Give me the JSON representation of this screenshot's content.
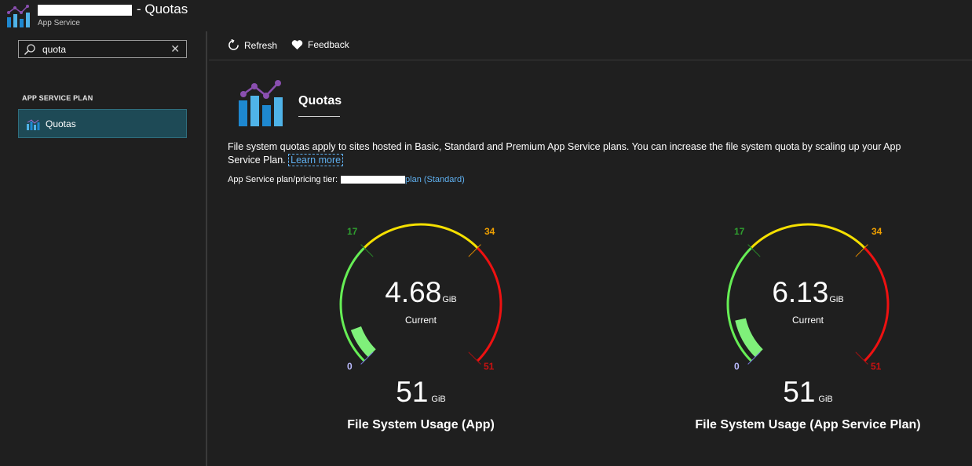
{
  "header": {
    "title_suffix": "- Quotas",
    "subtitle": "App Service"
  },
  "search": {
    "value": "quota",
    "clear_glyph": "✕"
  },
  "sidebar": {
    "section_label": "APP SERVICE PLAN",
    "items": [
      {
        "label": "Quotas",
        "icon": "bar-chart-icon",
        "selected": true
      }
    ]
  },
  "toolbar": {
    "refresh_label": "Refresh",
    "feedback_label": "Feedback"
  },
  "page": {
    "title": "Quotas",
    "description_line1": "File system quotas apply to sites hosted in Basic, Standard and Premium App Service plans. You can increase the file system quota by scaling up your App",
    "description_line2": "Service Plan.",
    "learn_more": "Learn more",
    "tier_label": "App Service plan/pricing tier:",
    "tier_value": "plan (Standard)"
  },
  "gauges": [
    {
      "name": "File System Usage (App)",
      "current_value": "4.68",
      "current_unit": "GiB",
      "current_label": "Current",
      "total_value": "51",
      "total_unit": "GiB",
      "tick_min": "0",
      "tick_green": "17",
      "tick_yellow": "34",
      "tick_max": "51",
      "fill_fraction": 0.0918
    },
    {
      "name": "File System Usage (App Service Plan)",
      "current_value": "6.13",
      "current_unit": "GiB",
      "current_label": "Current",
      "total_value": "51",
      "total_unit": "GiB",
      "tick_min": "0",
      "tick_green": "17",
      "tick_yellow": "34",
      "tick_max": "51",
      "fill_fraction": 0.1202
    }
  ],
  "colors": {
    "accent": "#5fb0f0",
    "green": "#66ee55",
    "yellow": "#f5e000",
    "red": "#ee1111",
    "fill": "#7ff07a",
    "selected_nav": "#1e4a56"
  }
}
